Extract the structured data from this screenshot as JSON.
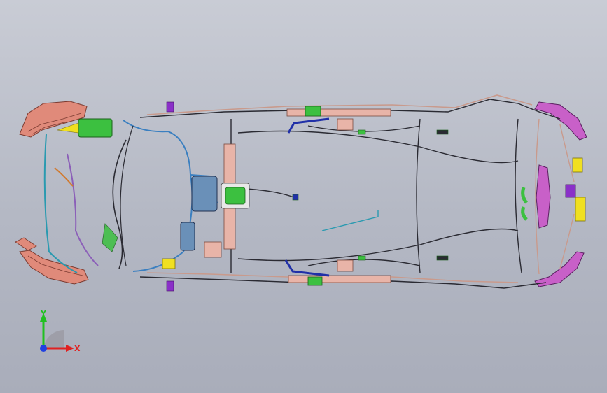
{
  "viewport": {
    "background": "#b4b8c4"
  },
  "colors": {
    "wire_dark": "#2a2a32",
    "wire_pink": "#c99a8c",
    "wire_blue": "#3a7fc0",
    "wire_cyan": "#2a9ab0",
    "wire_purple": "#8b5fb8",
    "wire_navy": "#2030a8",
    "wire_orange": "#d07a30",
    "tray_pink": "#e8b4a8",
    "lamp_salmon": "#e08a7a",
    "lamp_magenta": "#c860c8",
    "connector_green": "#3cc040",
    "connector_yellow": "#f0e020",
    "connector_purple": "#8a30c8",
    "axis_x": "#e02020",
    "axis_y": "#20c020",
    "axis_z": "#2040e0"
  },
  "triad": {
    "x_label": "X",
    "y_label": "Y",
    "icon": "coordinate-triad-icon"
  }
}
